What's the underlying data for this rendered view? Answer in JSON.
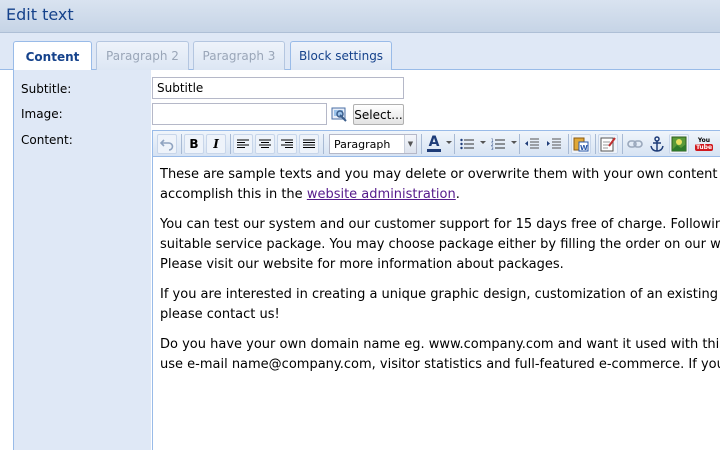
{
  "title": "Edit text",
  "tabs": [
    {
      "label": "Content",
      "state": "active"
    },
    {
      "label": "Paragraph 2",
      "state": "disabled"
    },
    {
      "label": "Paragraph 3",
      "state": "disabled"
    },
    {
      "label": "Block settings",
      "state": "normal"
    }
  ],
  "form": {
    "subtitle_label": "Subtitle:",
    "subtitle_value": "Subtitle",
    "image_label": "Image:",
    "image_value": "",
    "select_button": "Select...",
    "content_label": "Content:"
  },
  "toolbar": {
    "format_value": "Paragraph",
    "font_color_glyph": "A",
    "bold_glyph": "B",
    "italic_glyph": "I",
    "youtube_text": "You Tube"
  },
  "content": {
    "p1_line1": "These are sample texts and you may delete or overwrite them with your own content at any time. You can",
    "p1_line2_before": "accomplish this in the ",
    "p1_link": "website administration",
    "p1_line2_after": ".",
    "p2_line1": "You can test our system and our customer support for 15 days free of charge. Following this, please select a",
    "p2_line2": "suitable service package. You may choose package either by filling the order on our website or directly in administration.",
    "p2_line3": "Please visit our website for more information about packages.",
    "p3_line1": "If you are interested in creating a unique graphic design, customization of an existing design, or other services,",
    "p3_line2": "please contact us!",
    "p4_line1": "Do you have your own domain name eg. www.company.com and want it used with this website? Would you like to",
    "p4_line2": "use e-mail name@company.com, visitor statistics and full-featured e-commerce. If you have any questions..."
  },
  "colors": {
    "accent": "#15428b",
    "panel": "#dfe8f6",
    "border": "#99bbe8",
    "link": "#551a8b"
  }
}
